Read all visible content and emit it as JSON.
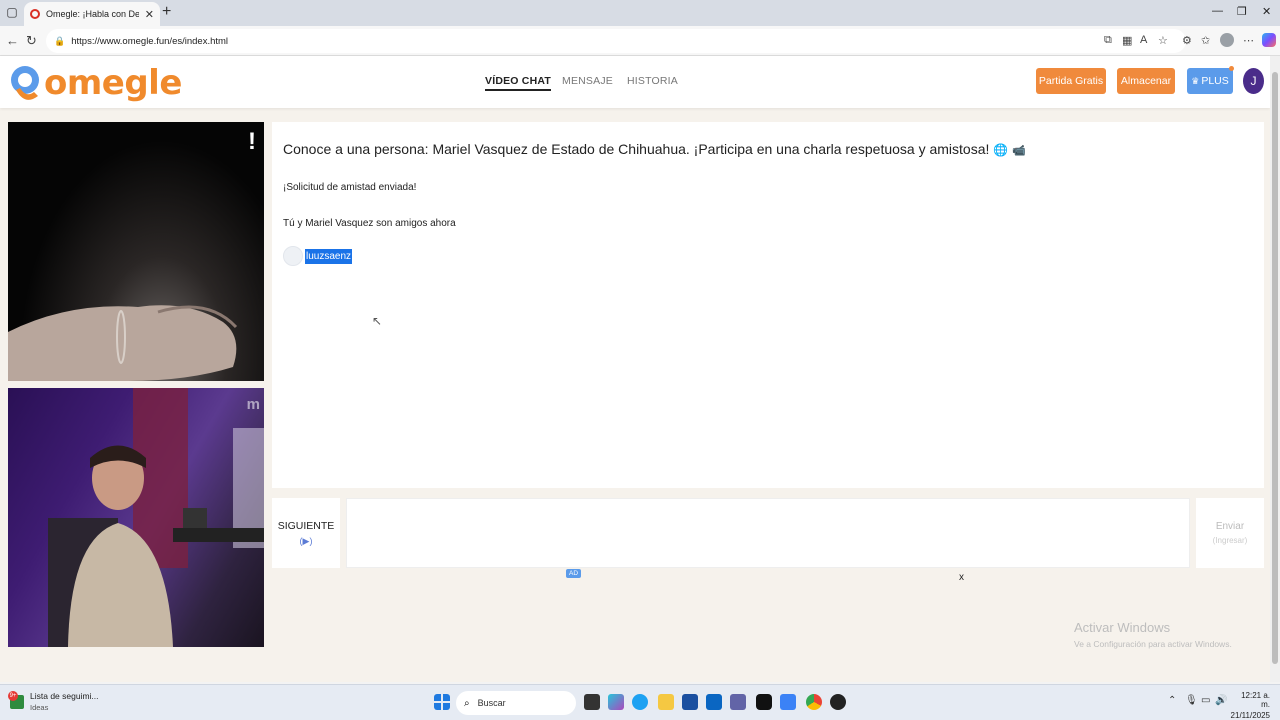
{
  "browser": {
    "tab_title": "Omegle: ¡Habla con Descono...",
    "url": "https://www.omegle.fun/es/index.html"
  },
  "site": {
    "logo_text": "omegle",
    "nav": [
      {
        "label": "VÍDEO CHAT",
        "active": true
      },
      {
        "label": "MENSAJE",
        "active": false
      },
      {
        "label": "HISTORIA",
        "active": false
      }
    ],
    "buttons": {
      "free_match": "Partida Gratis",
      "store": "Almacenar",
      "plus": "PLUS"
    },
    "user_initial": "J"
  },
  "video": {
    "stranger_alert": "!",
    "self_watermark": "m"
  },
  "chat": {
    "intro": "Conoce a una persona: Mariel Vasquez de Estado de Chihuahua. ¡Participa en una charla respetuosa y amistosa!",
    "messages": [
      "¡Solicitud de amistad enviada!",
      "Tú y Mariel Vasquez son amigos ahora"
    ],
    "username": "luuzsaenz"
  },
  "controls": {
    "next_label": "SIGUIENTE",
    "send_label": "Enviar",
    "send_hint": "(Ingresar)",
    "ad_badge": "AD",
    "ad_close": "x"
  },
  "os": {
    "activate_title": "Activar Windows",
    "activate_sub": "Ve a Configuración para activar Windows.",
    "widget_title": "Lista de seguimi...",
    "widget_sub": "Ideas",
    "widget_badge": "9+",
    "search_label": "Buscar",
    "time": "12:21 a. m.",
    "date": "21/11/2025"
  }
}
